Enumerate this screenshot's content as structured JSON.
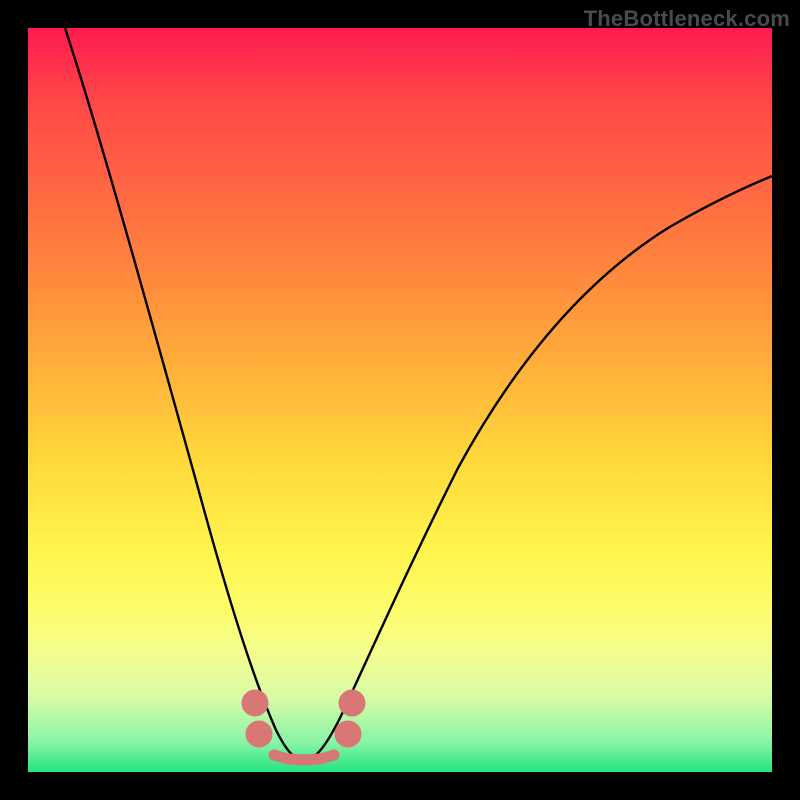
{
  "watermark": "TheBottleneck.com",
  "chart_data": {
    "type": "line",
    "title": "",
    "xlabel": "",
    "ylabel": "",
    "xlim": [
      0,
      100
    ],
    "ylim": [
      0,
      100
    ],
    "grid": false,
    "legend": false,
    "series": [
      {
        "name": "bottleneck-curve",
        "color": "#000000",
        "x": [
          5,
          8,
          12,
          16,
          20,
          23,
          26,
          28,
          30,
          32,
          34,
          36,
          37,
          38,
          40,
          42,
          45,
          50,
          55,
          60,
          65,
          70,
          75,
          80,
          85,
          90,
          95,
          100
        ],
        "values": [
          100,
          90,
          79,
          68,
          57,
          47,
          37,
          29,
          21,
          14,
          8,
          4,
          2,
          2,
          4,
          8,
          15,
          27,
          37,
          45,
          52,
          58,
          63,
          67,
          71,
          74,
          77,
          79
        ]
      },
      {
        "name": "bottleneck-markers",
        "color": "#d97777",
        "x": [
          30.5,
          31,
          33,
          35,
          37,
          39,
          41,
          43,
          43.5
        ],
        "values": [
          9,
          4.5,
          2.5,
          2,
          2,
          2,
          2.5,
          4.5,
          9
        ]
      }
    ]
  },
  "colors": {
    "curve": "#000000",
    "markers": "#d97777",
    "frame": "#000000"
  }
}
